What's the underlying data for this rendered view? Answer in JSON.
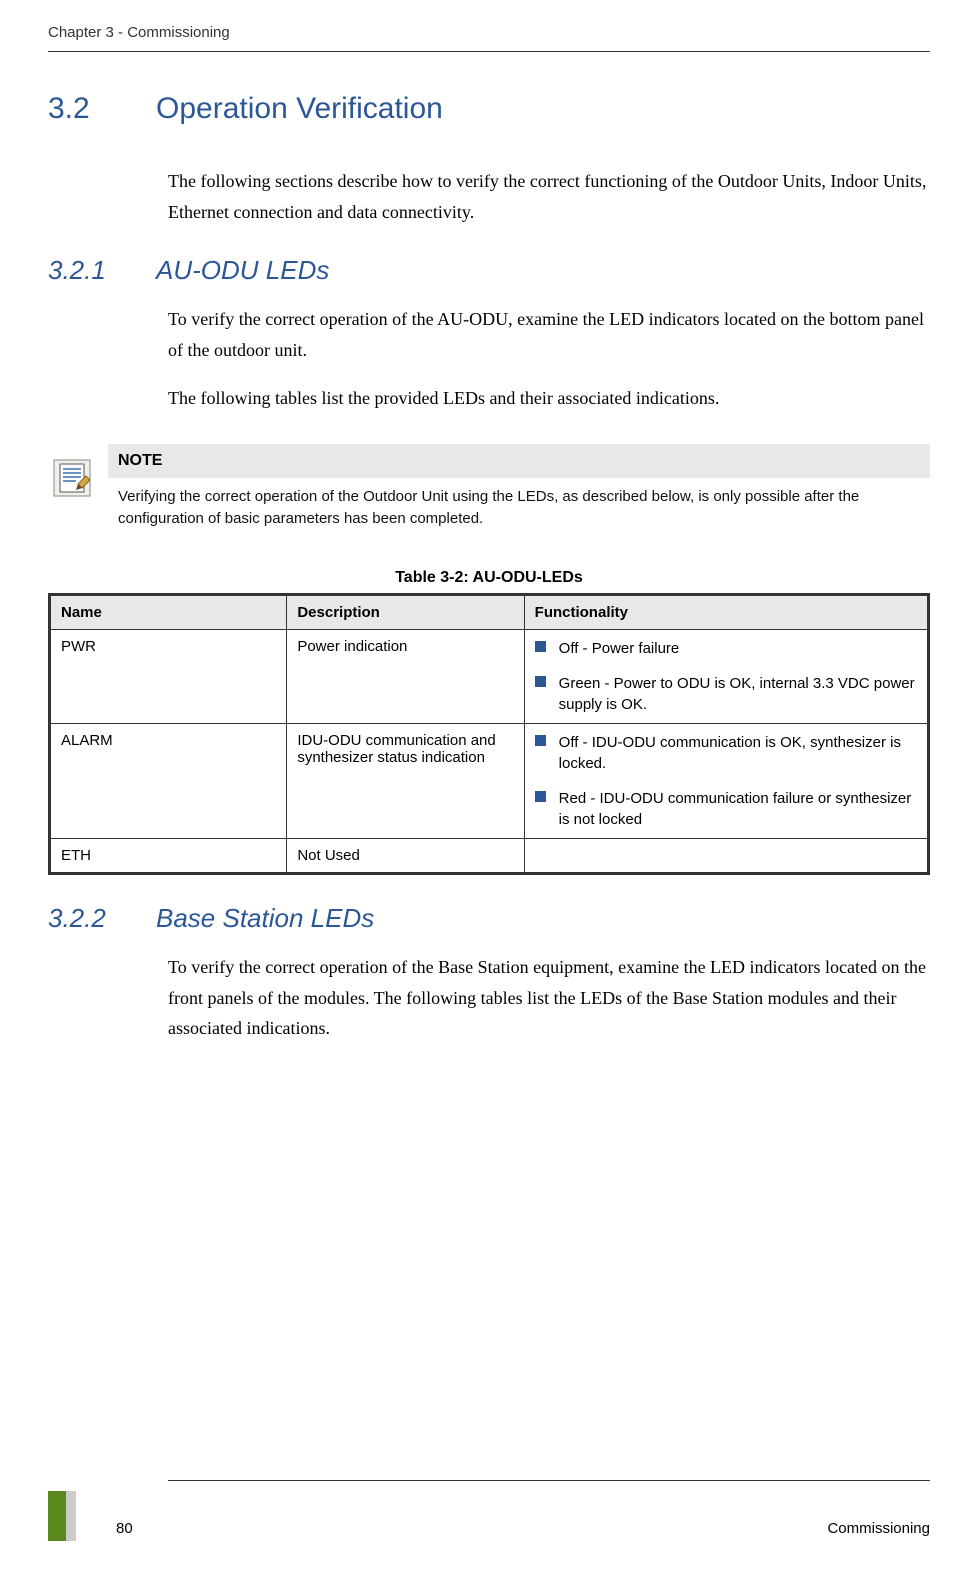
{
  "header": {
    "chapter": "Chapter 3 - Commissioning"
  },
  "section_3_2": {
    "number": "3.2",
    "title": "Operation Verification",
    "intro": "The following sections describe how to verify the correct functioning of the Outdoor Units, Indoor Units, Ethernet connection and data connectivity."
  },
  "section_3_2_1": {
    "number": "3.2.1",
    "title": "AU-ODU LEDs",
    "p1": "To verify the correct operation of the AU-ODU, examine the LED indicators located on the bottom panel of the outdoor unit.",
    "p2": "The following tables list the provided LEDs and their associated indications."
  },
  "note": {
    "label": "NOTE",
    "body": "Verifying the correct operation of the Outdoor Unit using the LEDs, as described below, is only possible after the configuration of basic parameters has been completed."
  },
  "table": {
    "caption": "Table 3-2: AU-ODU-LEDs",
    "headers": {
      "name": "Name",
      "description": "Description",
      "functionality": "Functionality"
    },
    "rows": [
      {
        "name": "PWR",
        "description": "Power indication",
        "functionality": [
          "Off - Power failure",
          "Green - Power to ODU is OK, internal 3.3 VDC power supply is OK."
        ]
      },
      {
        "name": "ALARM",
        "description": "IDU-ODU communication and synthesizer status indication",
        "functionality": [
          "Off - IDU-ODU communication is OK, synthesizer is locked.",
          "Red - IDU-ODU communication failure or synthesizer is not locked"
        ]
      },
      {
        "name": "ETH",
        "description": "Not Used",
        "functionality": []
      }
    ]
  },
  "section_3_2_2": {
    "number": "3.2.2",
    "title": "Base Station LEDs",
    "p1": "To verify the correct operation of the Base Station equipment, examine the LED indicators located on the front panels of the modules. The following tables list the LEDs of the Base Station modules and their associated indications."
  },
  "footer": {
    "page": "80",
    "title": "Commissioning"
  }
}
